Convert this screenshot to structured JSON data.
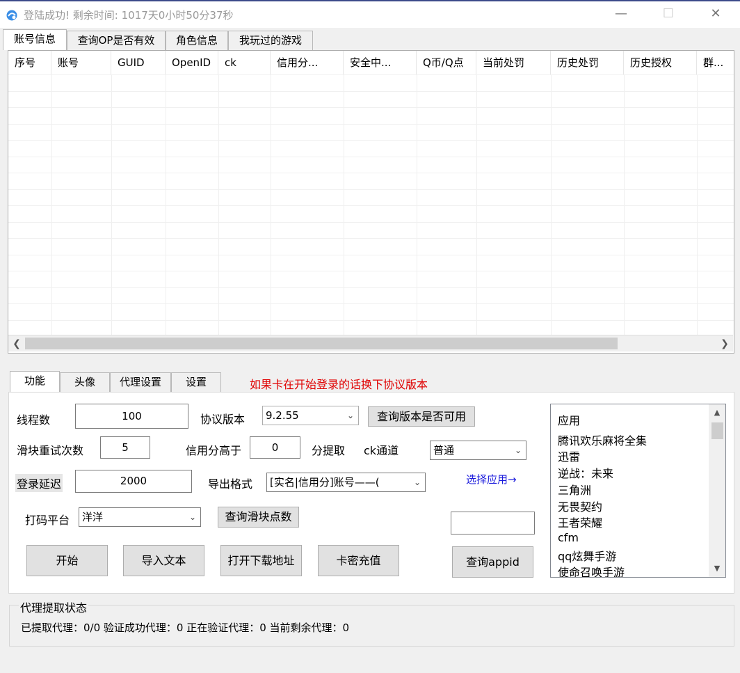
{
  "window": {
    "title": "登陆成功! 剩余时间: 1017天0小时50分37秒",
    "minimize": "—",
    "maximize": "☐",
    "close": "✕"
  },
  "top_tabs": [
    "账号信息",
    "查询OP是否有效",
    "角色信息",
    "我玩过的游戏"
  ],
  "grid": {
    "columns": [
      "序号",
      "账号",
      "GUID",
      "OpenID",
      "ck",
      "信用分...",
      "安全中...",
      "Q币/Q点",
      "当前处罚",
      "历史处罚",
      "历史授权",
      "群..."
    ]
  },
  "bottom_tabs": [
    "功能",
    "头像",
    "代理设置",
    "设置"
  ],
  "hint": "如果卡在开始登录的话换下协议版本",
  "form": {
    "threads_label": "线程数",
    "threads_value": "100",
    "protocol_label": "协议版本",
    "protocol_value": "9.2.55",
    "check_version_button": "查询版本是否可用",
    "slider_retry_label": "滑块重试次数",
    "slider_retry_value": "5",
    "credit_label": "信用分高于",
    "credit_value": "0",
    "credit_suffix": "分提取",
    "ck_channel_label": "ck通道",
    "ck_channel_value": "普通",
    "login_delay_label": "登录延迟",
    "login_delay_value": "2000",
    "export_label": "导出格式",
    "export_value": "[实名|信用分]账号——(",
    "select_app_link": "选择应用→",
    "captcha_label": "打码平台",
    "captcha_value": "洋洋",
    "query_slider_button": "查询滑块点数",
    "appid_value": ""
  },
  "buttons": {
    "start": "开始",
    "import": "导入文本",
    "open_download": "打开下载地址",
    "card_recharge": "卡密充值",
    "query_appid": "查询appid"
  },
  "apps": [
    "应用",
    "腾讯欢乐麻将全集",
    "迅雷",
    "逆战：未来",
    "三角洲",
    "无畏契约",
    "王者荣耀",
    "cfm",
    "qq炫舞手游",
    "使命召唤手游"
  ],
  "proxy": {
    "group_title": "代理提取状态",
    "status": "已提取代理：0/0 验证成功代理：0 正在验证代理：0 当前剩余代理：0"
  }
}
